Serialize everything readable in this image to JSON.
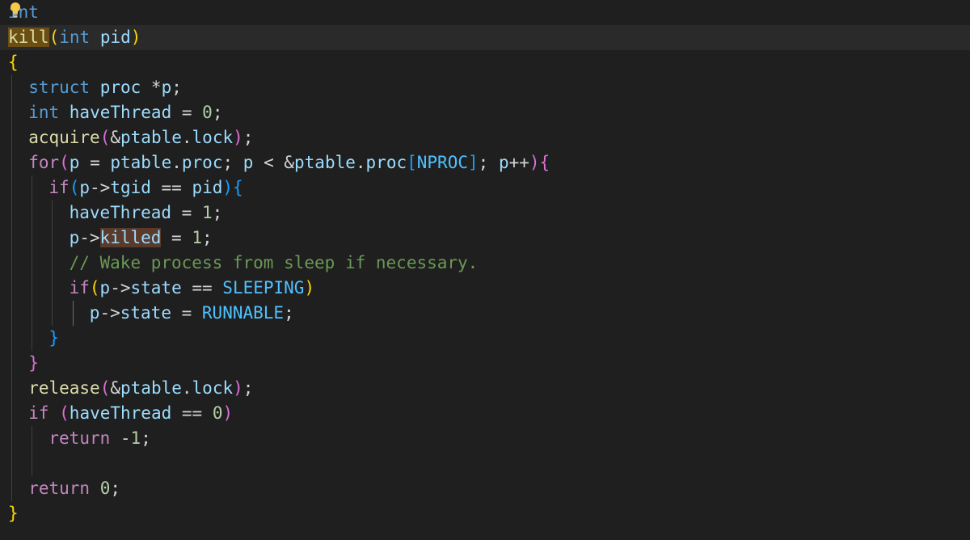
{
  "editor": {
    "lines": [
      {
        "tokens": [
          {
            "t": "int",
            "c": "kw"
          }
        ]
      },
      {
        "tokens": [
          {
            "t": "kill",
            "c": "fn hl"
          },
          {
            "t": "(",
            "c": "p1"
          },
          {
            "t": "int",
            "c": "kw"
          },
          {
            "t": " ",
            "c": "op"
          },
          {
            "t": "pid",
            "c": "var"
          },
          {
            "t": ")",
            "c": "p1"
          }
        ]
      },
      {
        "tokens": [
          {
            "t": "{",
            "c": "p1"
          }
        ]
      },
      {
        "tokens": [
          {
            "t": "struct",
            "c": "kw"
          },
          {
            "t": " ",
            "c": "op"
          },
          {
            "t": "proc",
            "c": "var"
          },
          {
            "t": " *",
            "c": "op"
          },
          {
            "t": "p",
            "c": "var"
          },
          {
            "t": ";",
            "c": "op"
          }
        ]
      },
      {
        "tokens": [
          {
            "t": "int",
            "c": "kw"
          },
          {
            "t": " ",
            "c": "op"
          },
          {
            "t": "haveThread",
            "c": "var"
          },
          {
            "t": " = ",
            "c": "op"
          },
          {
            "t": "0",
            "c": "num"
          },
          {
            "t": ";",
            "c": "op"
          }
        ]
      },
      {
        "tokens": [
          {
            "t": "acquire",
            "c": "fn"
          },
          {
            "t": "(",
            "c": "p2"
          },
          {
            "t": "&",
            "c": "op"
          },
          {
            "t": "ptable",
            "c": "var"
          },
          {
            "t": ".",
            "c": "op"
          },
          {
            "t": "lock",
            "c": "var"
          },
          {
            "t": ")",
            "c": "p2"
          },
          {
            "t": ";",
            "c": "op"
          }
        ]
      },
      {
        "tokens": [
          {
            "t": "for",
            "c": "ctl"
          },
          {
            "t": "(",
            "c": "p2"
          },
          {
            "t": "p",
            "c": "var"
          },
          {
            "t": " = ",
            "c": "op"
          },
          {
            "t": "ptable",
            "c": "var"
          },
          {
            "t": ".",
            "c": "op"
          },
          {
            "t": "proc",
            "c": "var"
          },
          {
            "t": "; ",
            "c": "op"
          },
          {
            "t": "p",
            "c": "var"
          },
          {
            "t": " < ",
            "c": "op"
          },
          {
            "t": "&",
            "c": "op"
          },
          {
            "t": "ptable",
            "c": "var"
          },
          {
            "t": ".",
            "c": "op"
          },
          {
            "t": "proc",
            "c": "var"
          },
          {
            "t": "[",
            "c": "p3"
          },
          {
            "t": "NPROC",
            "c": "const"
          },
          {
            "t": "]",
            "c": "p3"
          },
          {
            "t": "; ",
            "c": "op"
          },
          {
            "t": "p",
            "c": "var"
          },
          {
            "t": "++",
            "c": "op"
          },
          {
            "t": ")",
            "c": "p2"
          },
          {
            "t": "{",
            "c": "p2"
          }
        ]
      },
      {
        "tokens": [
          {
            "t": "if",
            "c": "ctl"
          },
          {
            "t": "(",
            "c": "p3"
          },
          {
            "t": "p",
            "c": "var"
          },
          {
            "t": "->",
            "c": "op"
          },
          {
            "t": "tgid",
            "c": "var"
          },
          {
            "t": " == ",
            "c": "op"
          },
          {
            "t": "pid",
            "c": "var"
          },
          {
            "t": ")",
            "c": "p3"
          },
          {
            "t": "{",
            "c": "p3"
          }
        ]
      },
      {
        "tokens": [
          {
            "t": "haveThread",
            "c": "var"
          },
          {
            "t": " = ",
            "c": "op"
          },
          {
            "t": "1",
            "c": "num"
          },
          {
            "t": ";",
            "c": "op"
          }
        ]
      },
      {
        "tokens": [
          {
            "t": "p",
            "c": "var"
          },
          {
            "t": "->",
            "c": "op"
          },
          {
            "t": "killed",
            "c": "var hl2"
          },
          {
            "t": " = ",
            "c": "op"
          },
          {
            "t": "1",
            "c": "num"
          },
          {
            "t": ";",
            "c": "op"
          }
        ]
      },
      {
        "tokens": [
          {
            "t": "// Wake process from sleep if necessary.",
            "c": "cmt"
          }
        ]
      },
      {
        "tokens": [
          {
            "t": "if",
            "c": "ctl"
          },
          {
            "t": "(",
            "c": "p1"
          },
          {
            "t": "p",
            "c": "var"
          },
          {
            "t": "->",
            "c": "op"
          },
          {
            "t": "state",
            "c": "var"
          },
          {
            "t": " == ",
            "c": "op"
          },
          {
            "t": "SLEEPING",
            "c": "const"
          },
          {
            "t": ")",
            "c": "p1"
          }
        ]
      },
      {
        "tokens": [
          {
            "t": "p",
            "c": "var"
          },
          {
            "t": "->",
            "c": "op"
          },
          {
            "t": "state",
            "c": "var"
          },
          {
            "t": " = ",
            "c": "op"
          },
          {
            "t": "RUNNABLE",
            "c": "const"
          },
          {
            "t": ";",
            "c": "op"
          }
        ]
      },
      {
        "tokens": [
          {
            "t": "}",
            "c": "p3"
          }
        ]
      },
      {
        "tokens": [
          {
            "t": "}",
            "c": "p2"
          }
        ]
      },
      {
        "tokens": [
          {
            "t": "release",
            "c": "fn"
          },
          {
            "t": "(",
            "c": "p2"
          },
          {
            "t": "&",
            "c": "op"
          },
          {
            "t": "ptable",
            "c": "var"
          },
          {
            "t": ".",
            "c": "op"
          },
          {
            "t": "lock",
            "c": "var"
          },
          {
            "t": ")",
            "c": "p2"
          },
          {
            "t": ";",
            "c": "op"
          }
        ]
      },
      {
        "tokens": [
          {
            "t": "if",
            "c": "ctl"
          },
          {
            "t": " ",
            "c": "op"
          },
          {
            "t": "(",
            "c": "p2"
          },
          {
            "t": "haveThread",
            "c": "var"
          },
          {
            "t": " == ",
            "c": "op"
          },
          {
            "t": "0",
            "c": "num"
          },
          {
            "t": ")",
            "c": "p2"
          }
        ]
      },
      {
        "tokens": [
          {
            "t": "return",
            "c": "ctl"
          },
          {
            "t": " -",
            "c": "op"
          },
          {
            "t": "1",
            "c": "num"
          },
          {
            "t": ";",
            "c": "op"
          }
        ]
      },
      {
        "tokens": []
      },
      {
        "tokens": [
          {
            "t": "return",
            "c": "ctl"
          },
          {
            "t": " ",
            "c": "op"
          },
          {
            "t": "0",
            "c": "num"
          },
          {
            "t": ";",
            "c": "op"
          }
        ]
      },
      {
        "tokens": [
          {
            "t": "}",
            "c": "p1"
          }
        ]
      }
    ]
  }
}
